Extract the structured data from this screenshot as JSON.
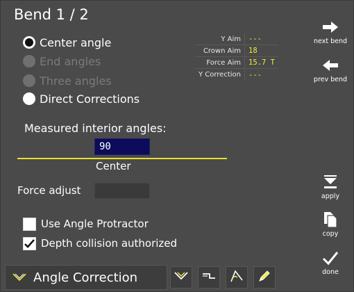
{
  "header": {
    "title": "Bend 1 / 2"
  },
  "modes": [
    {
      "label": "Center angle",
      "state": "selected"
    },
    {
      "label": "End angles",
      "state": "disabled"
    },
    {
      "label": "Three angles",
      "state": "disabled"
    },
    {
      "label": "Direct Corrections",
      "state": "enabled"
    }
  ],
  "aim_table": [
    {
      "label": "Y Aim",
      "value": "---"
    },
    {
      "label": "Crown Aim",
      "value": "18"
    },
    {
      "label": "Force Aim",
      "value": "15.7 T"
    },
    {
      "label": "Y Correction",
      "value": "---"
    }
  ],
  "sidebar": {
    "next_bend": "next bend",
    "prev_bend": "prev bend",
    "apply": "apply",
    "copy": "copy",
    "done": "done"
  },
  "measured": {
    "label": "Measured interior angles:",
    "value": "90",
    "position_label": "Center"
  },
  "force": {
    "label": "Force adjust",
    "value": ""
  },
  "options": [
    {
      "label": "Use Angle Protractor",
      "checked": false
    },
    {
      "label": "Depth collision authorized",
      "checked": true
    }
  ],
  "toolbar": {
    "mode_label": "Angle Correction",
    "icons": [
      "angle-down-icon",
      "step-profile-icon",
      "protractor-icon",
      "pencil-icon"
    ]
  },
  "colors": {
    "background": "#4a4a4a",
    "accent_yellow": "#f2e93a",
    "input_blue": "#0c0c5a"
  }
}
